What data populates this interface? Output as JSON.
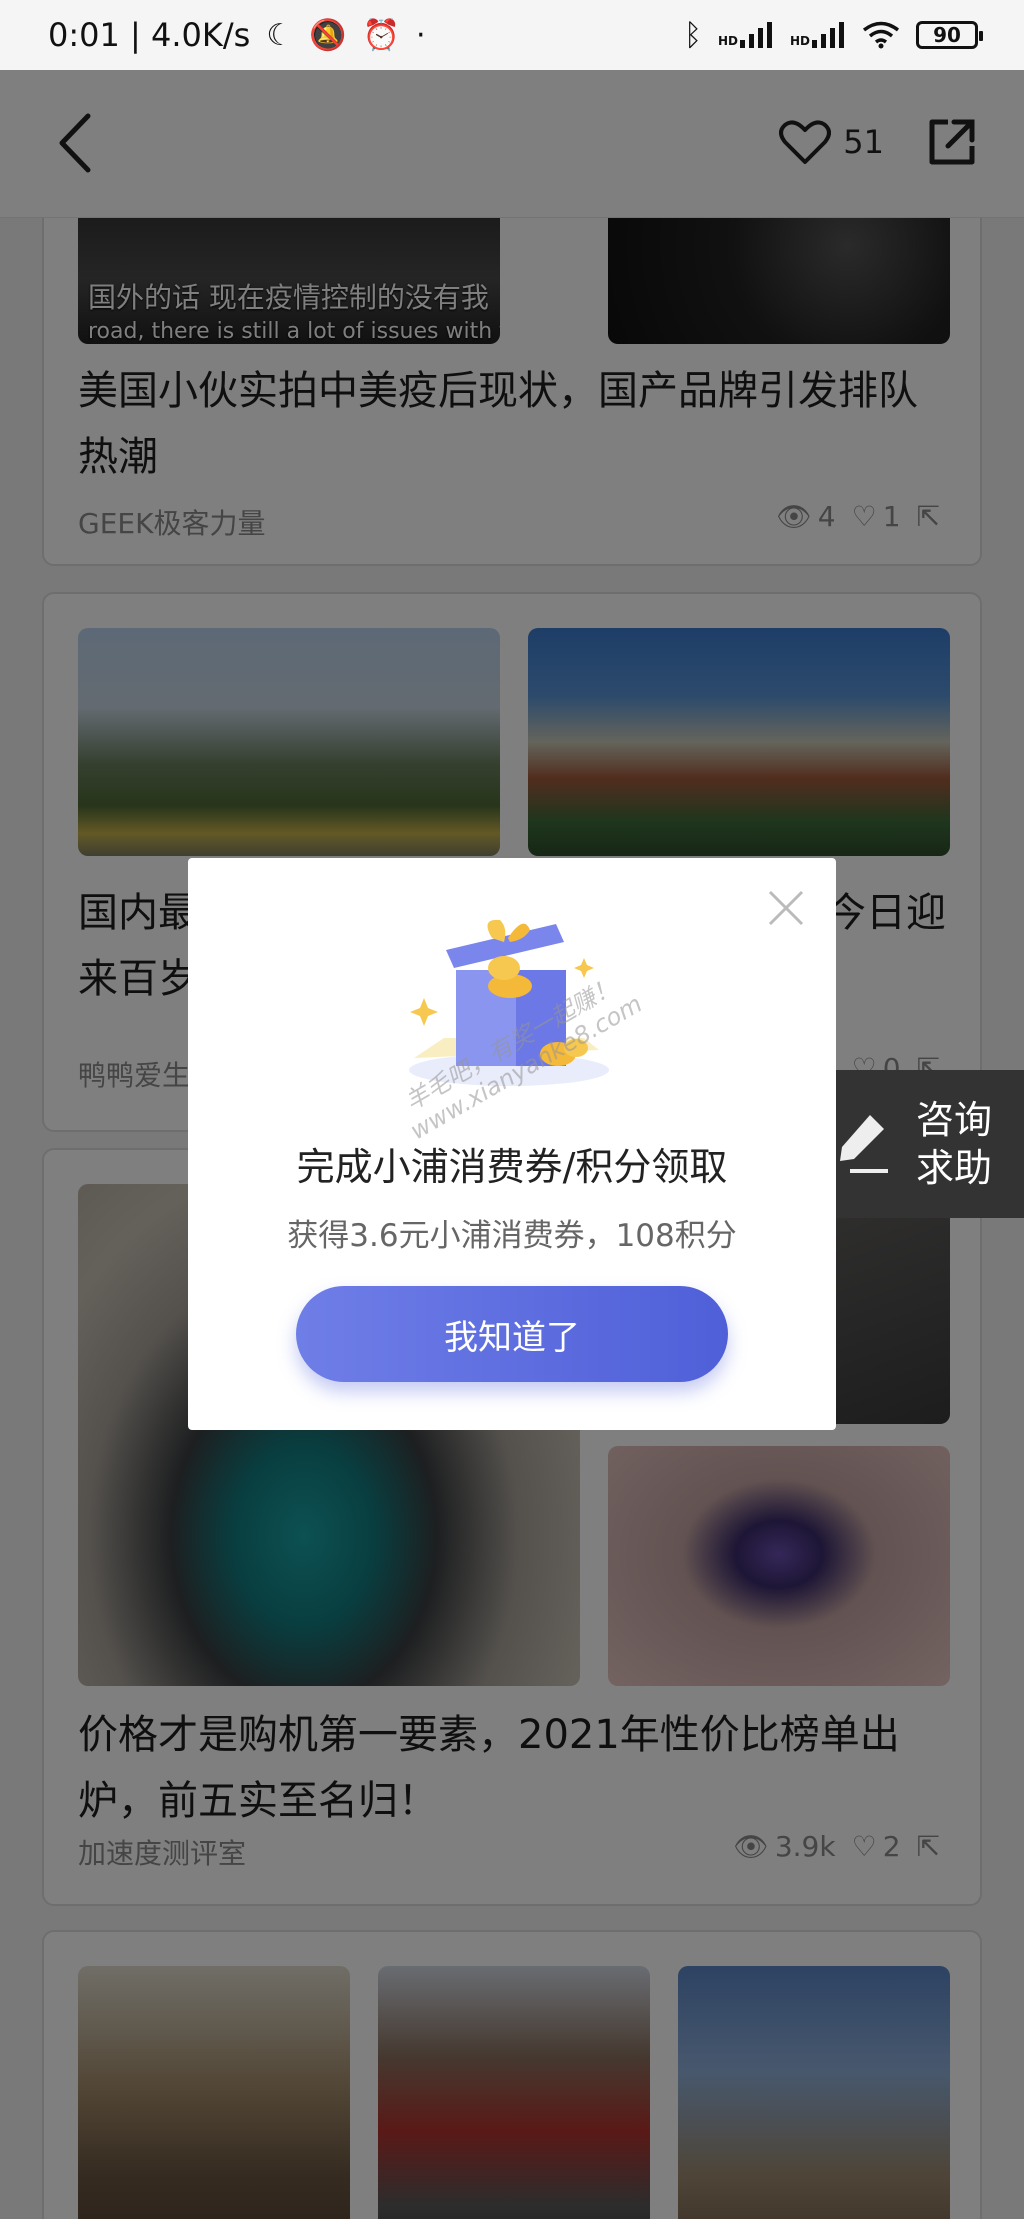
{
  "status_bar": {
    "time_speed": "0:01 | 4.0K/s",
    "icons_left": [
      "moon-icon",
      "mute-icon",
      "alarm-icon",
      "dot-icon"
    ],
    "icons_right": [
      "bluetooth-icon",
      "hd-signal-icon",
      "hd-signal-icon",
      "wifi-icon"
    ],
    "hd_label": "HD",
    "battery": "90"
  },
  "header": {
    "like_count": "51"
  },
  "feed": {
    "cards": [
      {
        "caption_cn": "国外的话 现在疫情控制的没有我",
        "caption_en": "road, there is still a lot of issues with the C",
        "title": "美国小伙实拍中美疫后现状，国产品牌引发排队热潮",
        "source": "GEEK极客力量",
        "views": "4",
        "likes": "1"
      },
      {
        "title_left": "国内最",
        "title_right": "今日迎",
        "title_line2": "来百岁",
        "source": "鸭鸭爱生",
        "likes": "0"
      },
      {
        "title": "价格才是购机第一要素，2021年性价比榜单出炉，前五实至名归！",
        "source": "加速度测评室",
        "views": "3.9k",
        "likes": "2"
      }
    ]
  },
  "consult": {
    "label": "咨询求助"
  },
  "modal": {
    "watermark_line1": "羊毛吧，有奖一起赚！",
    "watermark_line2": "www.xianyanke8.com",
    "title": "完成小浦消费券/积分领取",
    "subtitle": "获得3.6元小浦消费券，108积分",
    "button": "我知道了"
  }
}
